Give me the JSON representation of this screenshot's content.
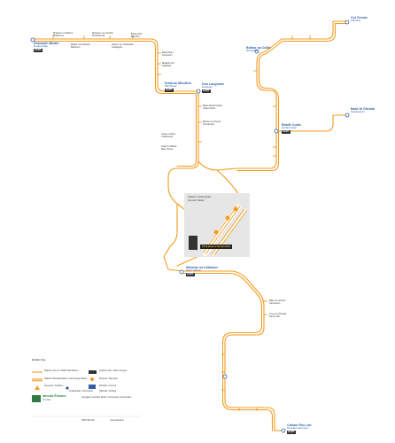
{
  "colors": {
    "route": "#f39c1f",
    "route_light": "#f8c98a",
    "station": "#2f5fa8",
    "dart": "#333333",
    "panel": "#e6e6e6"
  },
  "stations": {
    "s1": {
      "name": "Dhúnaidh Bhaile",
      "sub": "Dunlow Bay",
      "dart": "DART"
    },
    "s2": {
      "name": "Muileann na Boirne",
      "sub": "Millbourne"
    },
    "s3": {
      "name": "Bhaile na hAbhann",
      "sub": "Ballyriver"
    },
    "s4": {
      "name": "Muileann na Gaoithe",
      "sub": "Windmill Hill"
    },
    "s5": {
      "name": "Gleann an Chaisleáin",
      "sub": "Castleglen"
    },
    "s6": {
      "name": "Beannchar",
      "sub": "Banchor"
    },
    "s7": {
      "name": "Baile Dhún",
      "sub": "Dunstown"
    },
    "s8": {
      "name": "Mullach Ard",
      "sub": "Highfield"
    },
    "s9": {
      "name": "Sráid an Mhuilinn",
      "sub": "Mill Street",
      "dart": "DART"
    },
    "s10": {
      "name": "Dún Laoghaire",
      "sub": "Dunleary",
      "dart": "DART"
    },
    "s11": {
      "name": "Baile Átha Fhirdhia",
      "sub": "Ardee Road"
    },
    "s12": {
      "name": "Mhuire an Chnoic",
      "sub": "Knockmary"
    },
    "s13": {
      "name": "Ceann Cuilinn",
      "sub": "Cullenhead"
    },
    "s14": {
      "name": "Sráid an Bhaile",
      "sub": "Main Street"
    },
    "s15": {
      "name": "Bóthar na Coille",
      "sub": "Woodway"
    },
    "s16": {
      "name": "Bhaile Cuain",
      "sub": "Harbourtown",
      "dart": "DART"
    },
    "s17": {
      "name": "Cúl Chnoic",
      "sub": "Kilknock"
    },
    "s18": {
      "name": "Baile Uí Ghráda",
      "sub": "Gradystown"
    },
    "s19": {
      "name": "Stáisiún na hAbhann",
      "sub": "River Station",
      "dart": "DART"
    },
    "s20": {
      "name": "Cathair Ros Lair",
      "sub": "Rosslare Europort",
      "dart": "DART"
    },
    "s21": {
      "name": "Baile na Gcloch",
      "sub": "Stonetown"
    },
    "s22": {
      "name": "Cnoc an Phobail",
      "sub": "Parish Hill"
    }
  },
  "panel": {
    "title": "Stáisiún Ui Dhonghaile",
    "subtitle": "Donnelly Station",
    "you": "Tá tú anseo / You are here"
  },
  "legend": {
    "title": "Eochair / Key",
    "rows": [
      {
        "label": "Stáisiún na Líne / DART Rail Station",
        "note": "Seirbhísí eile / Other services"
      },
      {
        "label": "Stáisiún Idirmhalartaithe / Interchange Station",
        "note": "Dréimire / Step-free"
      },
      {
        "label": "Áiseanna / Facilities",
        "note": "Rochtain / Access"
      },
      {
        "label": "Ionad Eolais / Information",
        "note": "Páirceáil / Parking"
      }
    ],
    "brand": "Iarnród Éireann",
    "brand_sub": "Irish Rail",
    "tagline": "Ceangal le seirbhísí áitiúla / Connecting communities",
    "phone": "1850 366 222",
    "web": "www.irishrail.ie"
  }
}
